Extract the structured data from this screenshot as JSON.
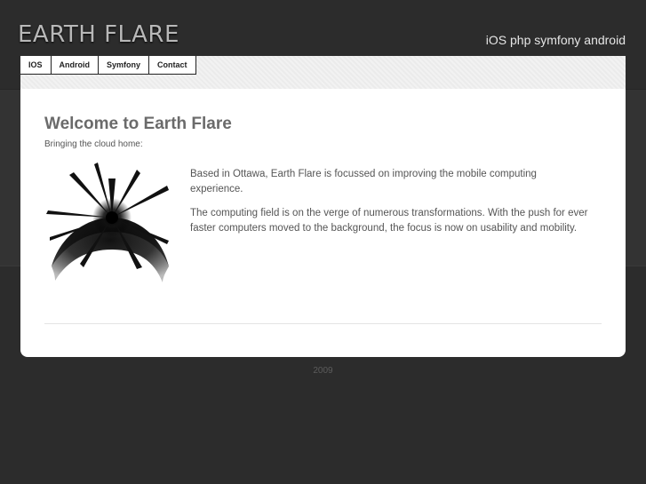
{
  "header": {
    "logo": "EARTH FLARE",
    "tagline": "iOS php symfony android"
  },
  "nav": {
    "items": [
      {
        "label": "IOS"
      },
      {
        "label": "Android"
      },
      {
        "label": "Symfony"
      },
      {
        "label": "Contact"
      }
    ]
  },
  "main": {
    "title": "Welcome to Earth Flare",
    "subtitle": "Bringing the cloud home:",
    "paragraphs": [
      "Based in Ottawa, Earth Flare is focussed on improving the mobile computing experience.",
      "The computing field is on the verge of numerous transformations. With the push for ever faster computers moved to the background, the focus is now on usability and mobility."
    ],
    "graphic_icon": "earth-flare-graphic"
  },
  "footer": {
    "text": "2009"
  }
}
